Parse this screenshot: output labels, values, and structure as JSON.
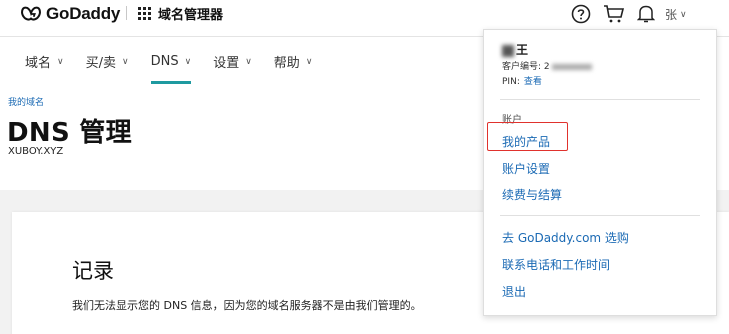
{
  "topbar": {
    "logo_text": "GoDaddy",
    "app_label": "域名管理器",
    "user_label": "张"
  },
  "icons": {
    "logo": "godaddy-logo-icon",
    "apps": "apps-grid-icon",
    "help": "help-icon",
    "cart": "cart-icon",
    "bell": "bell-icon",
    "chevron": "chevron-down-icon"
  },
  "nav": {
    "items": [
      {
        "label": "域名"
      },
      {
        "label": "买/卖"
      },
      {
        "label": "DNS"
      },
      {
        "label": "设置"
      },
      {
        "label": "帮助"
      }
    ],
    "active": "DNS"
  },
  "header": {
    "breadcrumb": "我的域名",
    "title": "DNS 管理",
    "domain": "XUBOY.XYZ"
  },
  "content": {
    "section_title": "记录",
    "notice": "我们无法显示您的 DNS 信息，因为您的域名服务器不是由我们管理的。"
  },
  "dropdown": {
    "name": "王",
    "customer_label": "客户编号: 2",
    "pin_label": "PIN:",
    "pin_link": "查看",
    "section_label": "账户",
    "items": [
      {
        "label": "我的产品"
      },
      {
        "label": "账户设置"
      },
      {
        "label": "续费与结算"
      },
      {
        "label": "去 GoDaddy.com 选购"
      },
      {
        "label": "联系电话和工作时间"
      },
      {
        "label": "退出"
      }
    ]
  },
  "colors": {
    "link": "#1b6ab4",
    "accent_teal": "#1e9aa0",
    "highlight_red": "#e0322d"
  }
}
